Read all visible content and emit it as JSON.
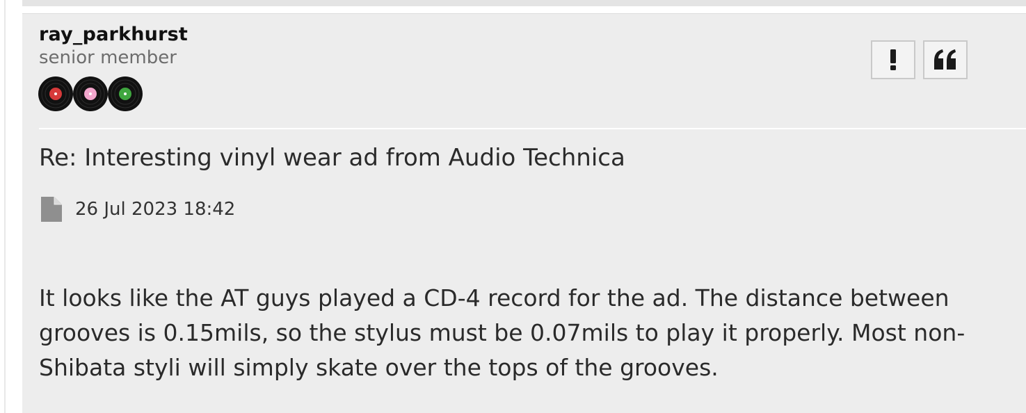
{
  "post": {
    "author": {
      "name": "ray_parkhurst",
      "rank": "senior member",
      "rank_icon": "three-vinyl-records",
      "rank_record_colors": [
        "#d63a3a",
        "#f2a6cc",
        "#3fa63f"
      ]
    },
    "actions": {
      "report_label": "!",
      "quote_label": "“"
    },
    "subject": "Re: Interesting vinyl wear ad from Audio Technica",
    "date_icon": "document-icon",
    "date": "26 Jul 2023 18:42",
    "body": "It looks like the AT guys played a CD-4 record for the ad. The distance between grooves is 0.15mils, so the stylus must be 0.07mils to play it properly. Most non-Shibata styli will simply skate over the tops of the grooves."
  }
}
